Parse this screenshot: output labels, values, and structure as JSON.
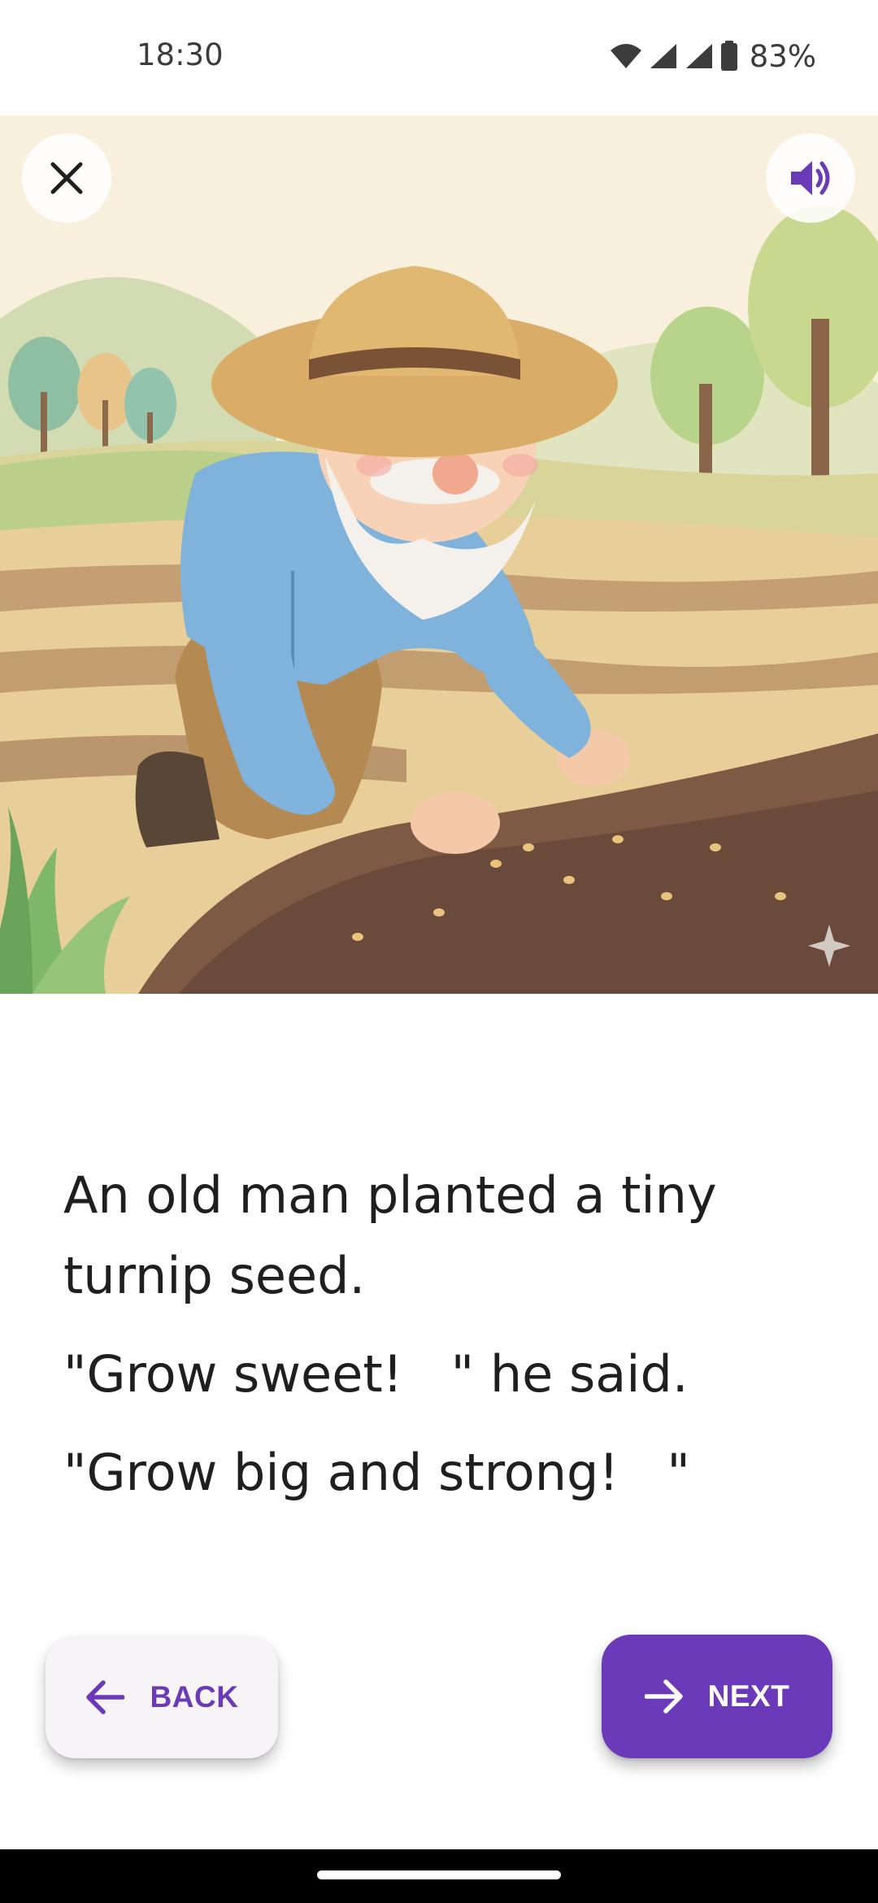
{
  "status_bar": {
    "time": "18:30",
    "battery_percent": "83%",
    "icons": [
      "wifi-icon",
      "signal-icon",
      "signal-icon",
      "battery-icon"
    ]
  },
  "illustration": {
    "icons": {
      "close": "close-icon",
      "audio": "speaker-icon"
    }
  },
  "story": {
    "lines": [
      "An old man planted a tiny turnip seed.",
      "\"Grow sweet!   \" he said.",
      "\"Grow big and strong!   \""
    ]
  },
  "navigation": {
    "back_label": "BACK",
    "next_label": "NEXT",
    "back_icon": "arrow-left-icon",
    "next_icon": "arrow-right-icon"
  },
  "colors": {
    "accent": "#6a3ab8",
    "text": "#1f1f1f",
    "back_button_bg": "#f6f4f7"
  }
}
